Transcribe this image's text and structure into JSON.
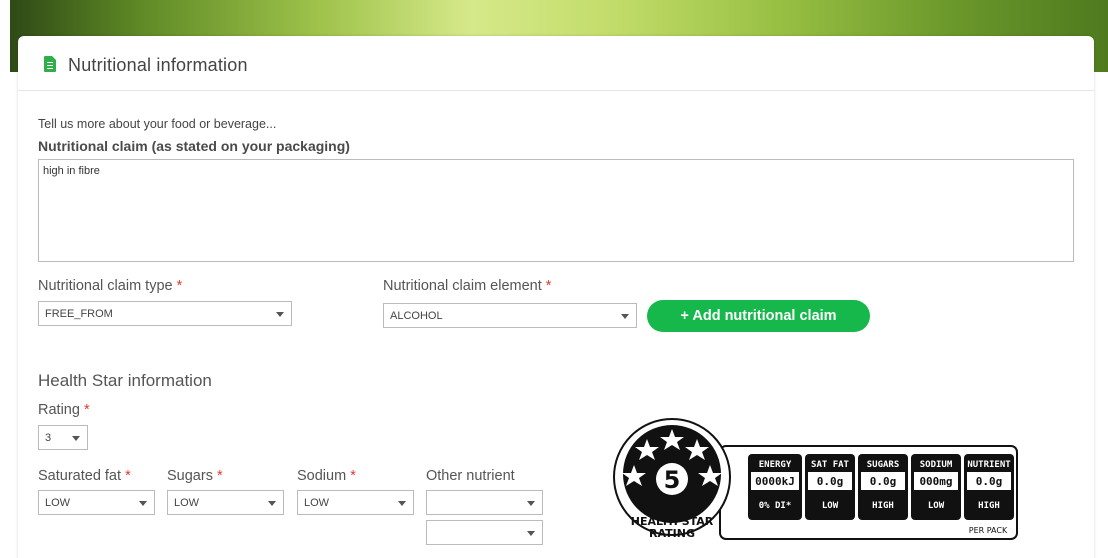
{
  "card": {
    "title": "Nutritional information",
    "icon": "document-icon"
  },
  "intro": "Tell us more about your food or beverage...",
  "claim": {
    "label": "Nutritional claim (as stated on your packaging)",
    "value": "high in fibre"
  },
  "claim_type": {
    "label": "Nutritional claim type",
    "required": "*",
    "value": "FREE_FROM"
  },
  "claim_element": {
    "label": "Nutritional claim element",
    "required": "*",
    "value": "ALCOHOL"
  },
  "add_button": {
    "label": "+ Add nutritional claim",
    "color": "#16b84c"
  },
  "health_star": {
    "title": "Health Star information",
    "rating": {
      "label": "Rating",
      "required": "*",
      "value": "3"
    },
    "saturated_fat": {
      "label": "Saturated fat",
      "required": "*",
      "value": "LOW"
    },
    "sugars": {
      "label": "Sugars",
      "required": "*",
      "value": "LOW"
    },
    "sodium": {
      "label": "Sodium",
      "required": "*",
      "value": "LOW"
    },
    "other_nutrient": {
      "label": "Other nutrient",
      "value": "",
      "value2": ""
    }
  },
  "hsr_graphic": {
    "stars_value": "5",
    "caption_line1": "HEALTH STAR",
    "caption_line2": "RATING",
    "columns": [
      {
        "header": "ENERGY",
        "value": "0000kJ",
        "level": "0% DI*"
      },
      {
        "header": "SAT FAT",
        "value": "0.0g",
        "level": "LOW"
      },
      {
        "header": "SUGARS",
        "value": "0.0g",
        "level": "HIGH"
      },
      {
        "header": "SODIUM",
        "value": "000mg",
        "level": "LOW"
      },
      {
        "header": "NUTRIENT",
        "value": "0.0g",
        "level": "HIGH"
      }
    ],
    "per_pack": "PER PACK"
  }
}
